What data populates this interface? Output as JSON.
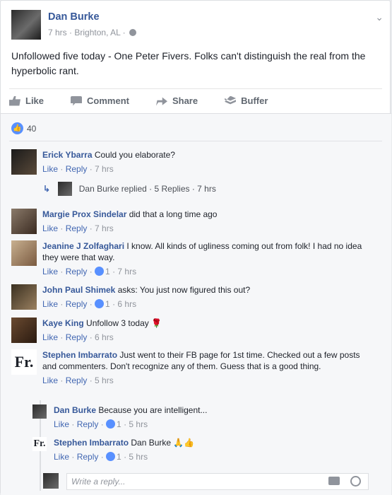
{
  "post": {
    "author": "Dan Burke",
    "time": "7 hrs",
    "location": "Brighton, AL",
    "separator": "·",
    "text": "Unfollowed five today - One Peter Fivers. Folks can't distinguish the real from the hyperbolic rant."
  },
  "actions": {
    "like": "Like",
    "comment": "Comment",
    "share": "Share",
    "buffer": "Buffer"
  },
  "reactions": {
    "count": "40"
  },
  "comments": [
    {
      "name": "Erick Ybarra",
      "text": "Could you elaborate?",
      "like": "Like",
      "reply": "Reply",
      "time": "7 hrs"
    },
    {
      "name": "Margie Prox Sindelar",
      "text": "did that a long time ago",
      "like": "Like",
      "reply": "Reply",
      "time": "7 hrs"
    },
    {
      "name": "Jeanine J Zolfaghari",
      "text": "I know. All kinds of ugliness coming out from folk! I had no idea they were that way.",
      "like": "Like",
      "reply": "Reply",
      "likes": "1",
      "time": "7 hrs"
    },
    {
      "name": "John Paul Shimek",
      "text": "asks: You just now figured this out?",
      "like": "Like",
      "reply": "Reply",
      "likes": "1",
      "time": "6 hrs"
    },
    {
      "name": "Kaye King",
      "text": "Unfollow 3 today 🌹",
      "like": "Like",
      "reply": "Reply",
      "time": "6 hrs"
    },
    {
      "name": "Stephen Imbarrato",
      "text": "Just went to their FB page for 1st time. Checked out a few posts and commenters. Don't recognize any of them. Guess that is a good thing.",
      "like": "Like",
      "reply": "Reply",
      "time": "5 hrs"
    }
  ],
  "replied_summary": {
    "name": "Dan Burke",
    "text": "replied · 5 Replies · 7 hrs"
  },
  "replies": [
    {
      "name": "Dan Burke",
      "text": "Because you are intelligent...",
      "like": "Like",
      "reply": "Reply",
      "likes": "1",
      "time": "5 hrs"
    },
    {
      "name": "Stephen Imbarrato",
      "text": "Dan Burke 🙏👍",
      "like": "Like",
      "reply": "Reply",
      "likes": "1",
      "time": "5 hrs"
    }
  ],
  "composer": {
    "placeholder": "Write a reply..."
  },
  "icons": {
    "fr_logo": "Fr."
  },
  "colors": {
    "link": "#365899",
    "meta": "#90949c",
    "accent": "#5890ff"
  }
}
